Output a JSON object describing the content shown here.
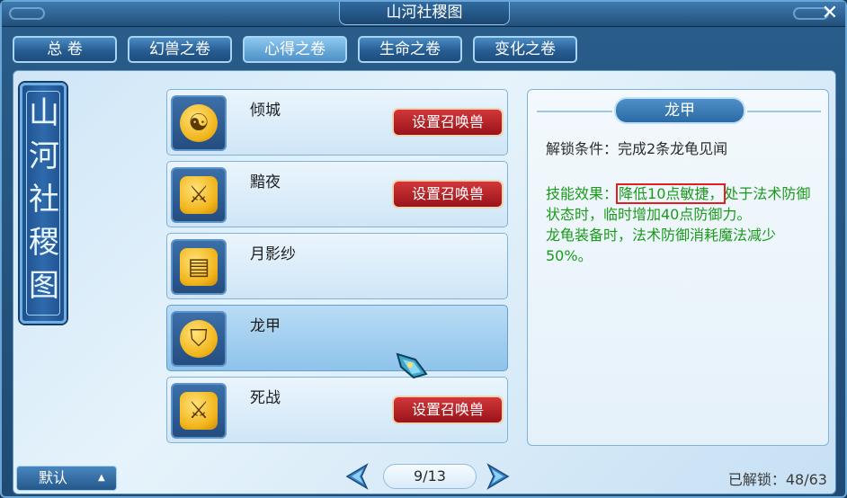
{
  "window": {
    "title": "山河社稷图",
    "close_label": "✕"
  },
  "tabs": [
    {
      "label": "总 卷",
      "active": false
    },
    {
      "label": "幻兽之卷",
      "active": false
    },
    {
      "label": "心得之卷",
      "active": true
    },
    {
      "label": "生命之卷",
      "active": false
    },
    {
      "label": "变化之卷",
      "active": false
    }
  ],
  "banner": {
    "chars": [
      "山",
      "河",
      "社",
      "稷",
      "图"
    ]
  },
  "list": [
    {
      "name": "倾城",
      "icon": "yin-yang-icon",
      "glyph": "☯",
      "button": "设置召唤兽",
      "selected": false
    },
    {
      "name": "黯夜",
      "icon": "sword-icon",
      "glyph": "⚔",
      "button": "设置召唤兽",
      "selected": false
    },
    {
      "name": "月影纱",
      "icon": "chest-icon",
      "glyph": "▤",
      "button": "",
      "selected": false
    },
    {
      "name": "龙甲",
      "icon": "shield-icon",
      "glyph": "⛉",
      "button": "",
      "selected": true
    },
    {
      "name": "死战",
      "icon": "sword-icon",
      "glyph": "⚔",
      "button": "设置召唤兽",
      "selected": false
    }
  ],
  "detail": {
    "title": "龙甲",
    "unlock_condition": "解锁条件：完成2条龙龟见闻",
    "effect_prefix": "技能效果：",
    "effect_highlight": "降低10点敏捷，",
    "effect_rest": "处于法术防御状态时，临时增加40点防御力。",
    "effect_line2": "龙龟装备时，法术防御消耗魔法减少50%。"
  },
  "footer": {
    "default_label": "默认",
    "default_arrow": "▲",
    "page": "9/13",
    "unlocked": "已解锁：48/63"
  },
  "colors": {
    "effect_text": "#1a9a1a",
    "highlight_border": "#e02020",
    "summon_button": "#b8222a"
  }
}
